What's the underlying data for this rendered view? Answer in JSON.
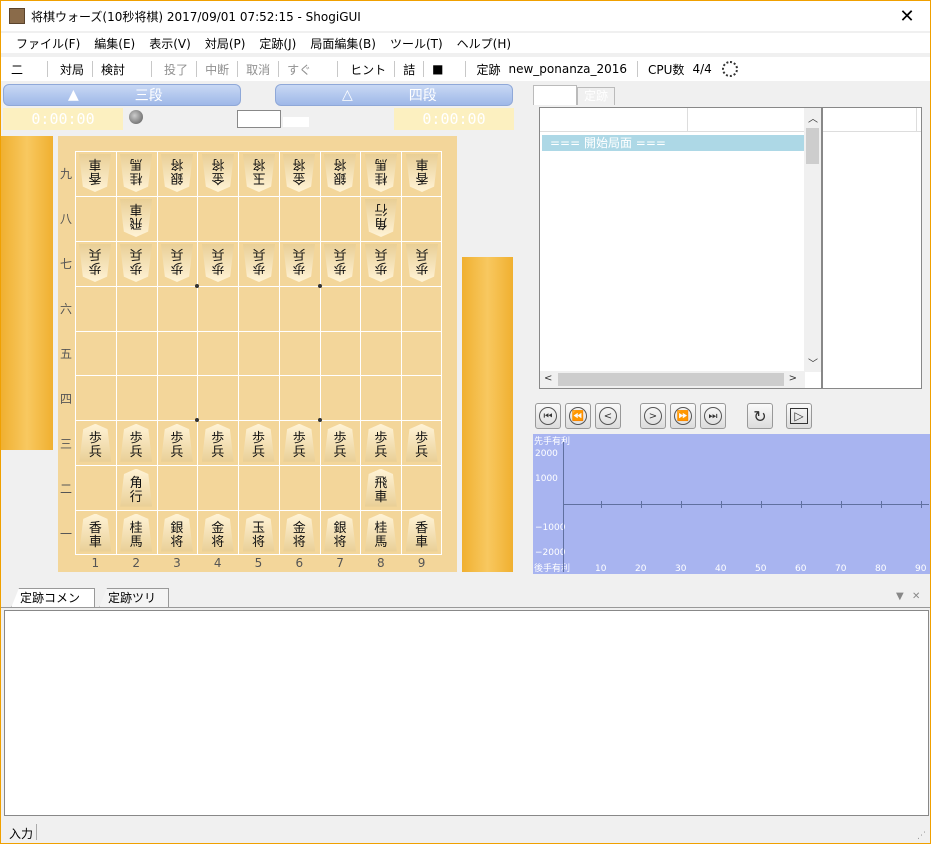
{
  "window": {
    "title": "将棋ウォーズ(10秒将棋) 2017/09/01 07:52:15 - ShogiGUI",
    "close_glyph": "✕"
  },
  "menu": [
    "ファイル(F)",
    "編集(E)",
    "表示(V)",
    "対局(P)",
    "定跡(J)",
    "局面編集(B)",
    "ツール(T)",
    "ヘルプ(H)"
  ],
  "toolbar": {
    "items": [
      {
        "label": "二",
        "enabled": true
      },
      {
        "label": "対局",
        "enabled": true
      },
      {
        "label": "検討",
        "enabled": true
      },
      {
        "label": "投了",
        "enabled": false
      },
      {
        "label": "中断",
        "enabled": false
      },
      {
        "label": "取消",
        "enabled": false
      },
      {
        "label": "すぐ",
        "enabled": false
      },
      {
        "label": "ヒント",
        "enabled": true
      },
      {
        "label": "詰",
        "enabled": true
      },
      {
        "label": "■",
        "enabled": true
      }
    ],
    "engine_label": "定跡",
    "engine_name": "new_ponanza_2016",
    "cpu_label": "CPU数",
    "cpu_value": "4/4"
  },
  "players": {
    "sente": {
      "mark": "▲",
      "rank": "三段",
      "time": "0:00:00"
    },
    "gote": {
      "mark": "△",
      "rank": "四段",
      "time": "0:00:00"
    }
  },
  "board": {
    "rank_labels": [
      "九",
      "八",
      "七",
      "六",
      "五",
      "四",
      "三",
      "二",
      "一"
    ],
    "file_labels": [
      "1",
      "2",
      "3",
      "4",
      "5",
      "6",
      "7",
      "8",
      "9"
    ],
    "gote_back": [
      "香車",
      "桂馬",
      "銀将",
      "金将",
      "玉将",
      "金将",
      "銀将",
      "桂馬",
      "香車"
    ],
    "gote_rook": "飛車",
    "gote_bishop": "角行",
    "gote_pawn": "歩兵",
    "sente_pawn": "歩兵",
    "sente_bishop": "角行",
    "sente_rook": "飛車",
    "sente_back": [
      "香車",
      "桂馬",
      "銀将",
      "金将",
      "玉将",
      "金将",
      "銀将",
      "桂馬",
      "香車"
    ]
  },
  "kifu_panel": {
    "tabs": [
      "",
      "定跡"
    ],
    "first_move": "=== 開始局面 ==="
  },
  "nav_buttons": [
    "first",
    "prev-10",
    "prev",
    "next",
    "next-10",
    "last",
    "flip",
    "play"
  ],
  "eval_graph": {
    "top_label": "先手有利",
    "bottom_label": "後手有利",
    "y_ticks": [
      "2000",
      "1000",
      "−1000",
      "−2000"
    ],
    "x_ticks": [
      "10",
      "20",
      "30",
      "40",
      "50",
      "60",
      "70",
      "80",
      "90"
    ]
  },
  "bottom_tabs": [
    "定跡コメント",
    "定跡ツリー"
  ],
  "status": {
    "text": "入力"
  }
}
